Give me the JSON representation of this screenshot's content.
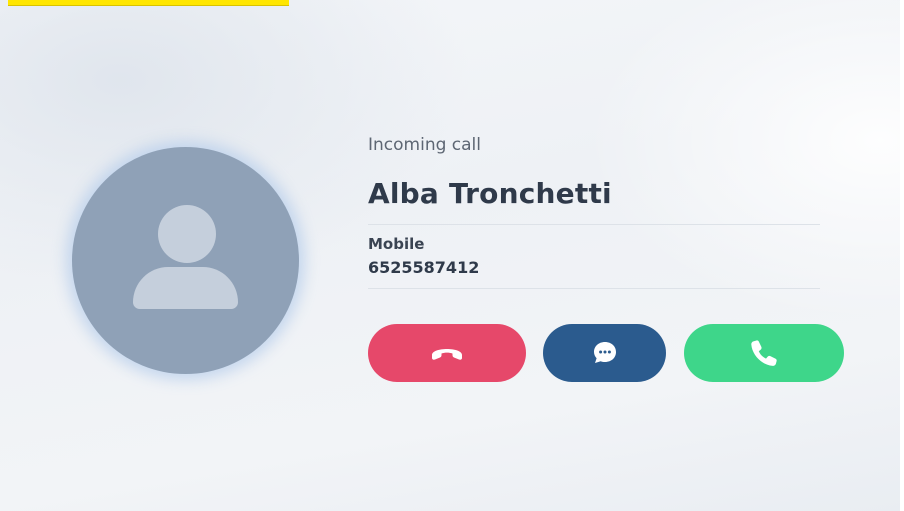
{
  "call": {
    "status": "Incoming call",
    "caller_name": "Alba Tronchetti",
    "number_type": "Mobile",
    "number": "6525587412"
  },
  "actions": {
    "decline": {
      "icon": "phone-hangup-icon",
      "color": "#e6486a"
    },
    "message": {
      "icon": "message-bubble-icon",
      "color": "#2b5b8e"
    },
    "answer": {
      "icon": "phone-answer-icon",
      "color": "#3ed68a"
    }
  },
  "avatar": {
    "icon": "person-silhouette-icon",
    "color": "#8fa1b7"
  },
  "colors": {
    "text_primary": "#2f3a4a",
    "text_secondary": "#5d6673",
    "highlight": "#ffe600"
  }
}
